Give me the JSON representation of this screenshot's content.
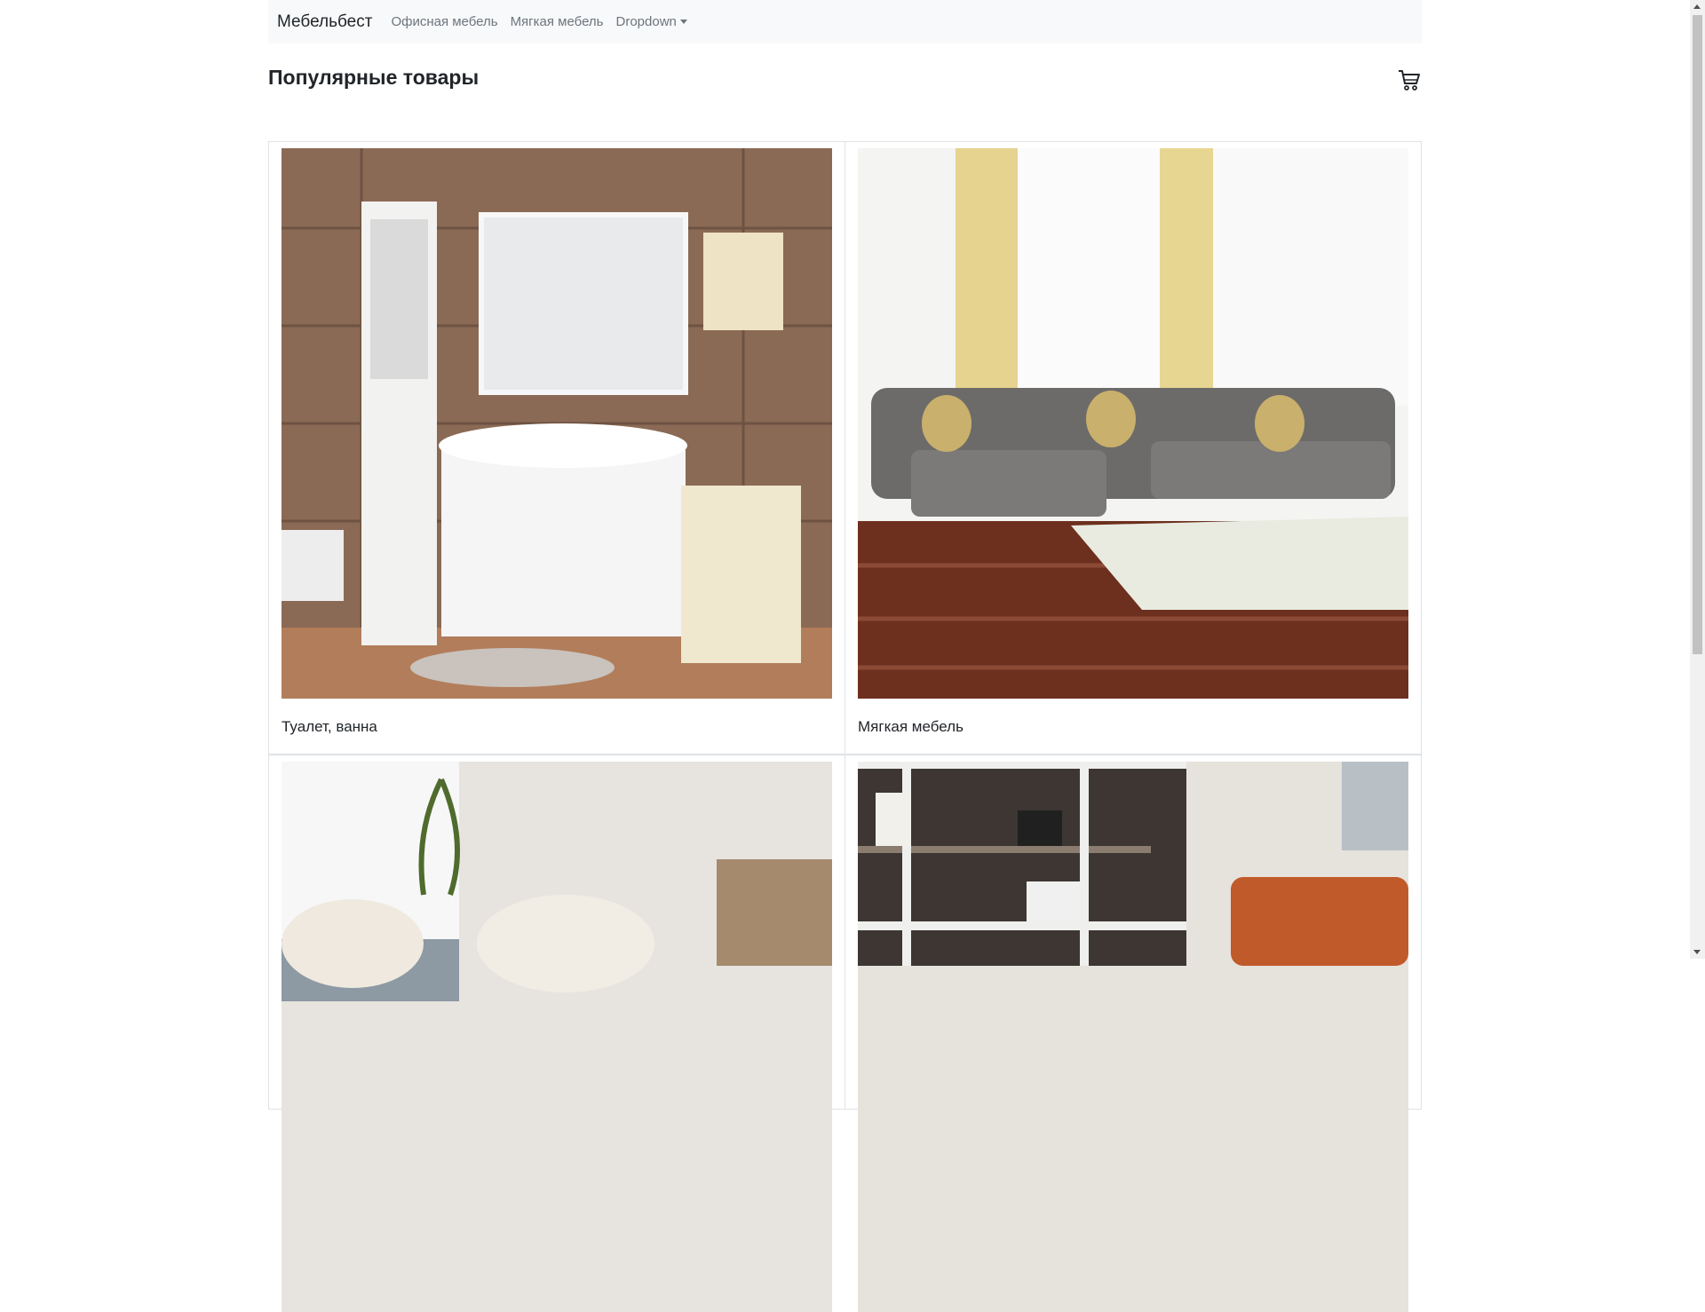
{
  "navbar": {
    "brand": "Мебельбест",
    "links": [
      "Офисная мебель",
      "Мягкая мебель",
      "Dropdown"
    ]
  },
  "header": {
    "title": "Популярные товары",
    "cart_icon": "cart-icon"
  },
  "products": [
    {
      "label": "Туалет, ванна",
      "image": "bathroom-furniture-photo"
    },
    {
      "label": "Мягкая мебель",
      "image": "sectional-sofa-photo"
    },
    {
      "label": "",
      "image": "armchairs-photo"
    },
    {
      "label": "",
      "image": "bookshelf-photo"
    }
  ],
  "colors": {
    "navbar_bg": "#f8f9fa",
    "link": "#6c757d",
    "text": "#212529"
  }
}
